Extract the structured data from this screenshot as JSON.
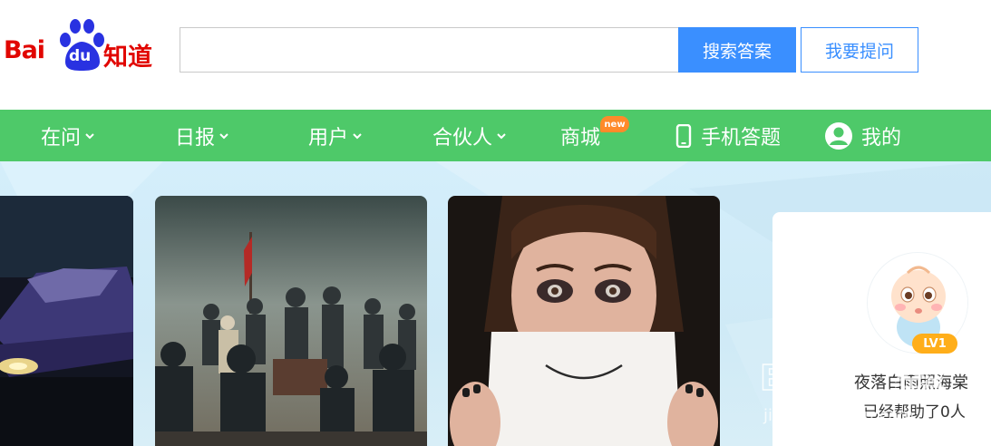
{
  "logo": {
    "bai": "Bai",
    "du": "du",
    "zhidao": "知道"
  },
  "search": {
    "value": "",
    "placeholder": "",
    "button_label": "搜索答案"
  },
  "ask_button_label": "我要提问",
  "nav": {
    "items": [
      {
        "label": "在问",
        "has_dropdown": true
      },
      {
        "label": "日报",
        "has_dropdown": true
      },
      {
        "label": "用户",
        "has_dropdown": true
      },
      {
        "label": "合伙人",
        "has_dropdown": true
      },
      {
        "label": "商城",
        "has_dropdown": false,
        "badge": "new"
      },
      {
        "label": "手机答题",
        "icon": "phone-icon"
      },
      {
        "label": "我的",
        "icon": "user-avatar-icon"
      }
    ]
  },
  "carousel": [
    {
      "image": "purple-classic-car"
    },
    {
      "image": "ancient-soldiers-army"
    },
    {
      "image": "woman-holding-smile-paper"
    }
  ],
  "profile": {
    "level": "LV1",
    "username": "夜落白雨照海棠",
    "help_text": "已经帮助了0人"
  },
  "colors": {
    "nav_green": "#4ec969",
    "search_blue": "#3a8fff",
    "logo_red": "#e10601",
    "level_orange": "#ffae1a",
    "new_badge": "#ff8a2a"
  }
}
